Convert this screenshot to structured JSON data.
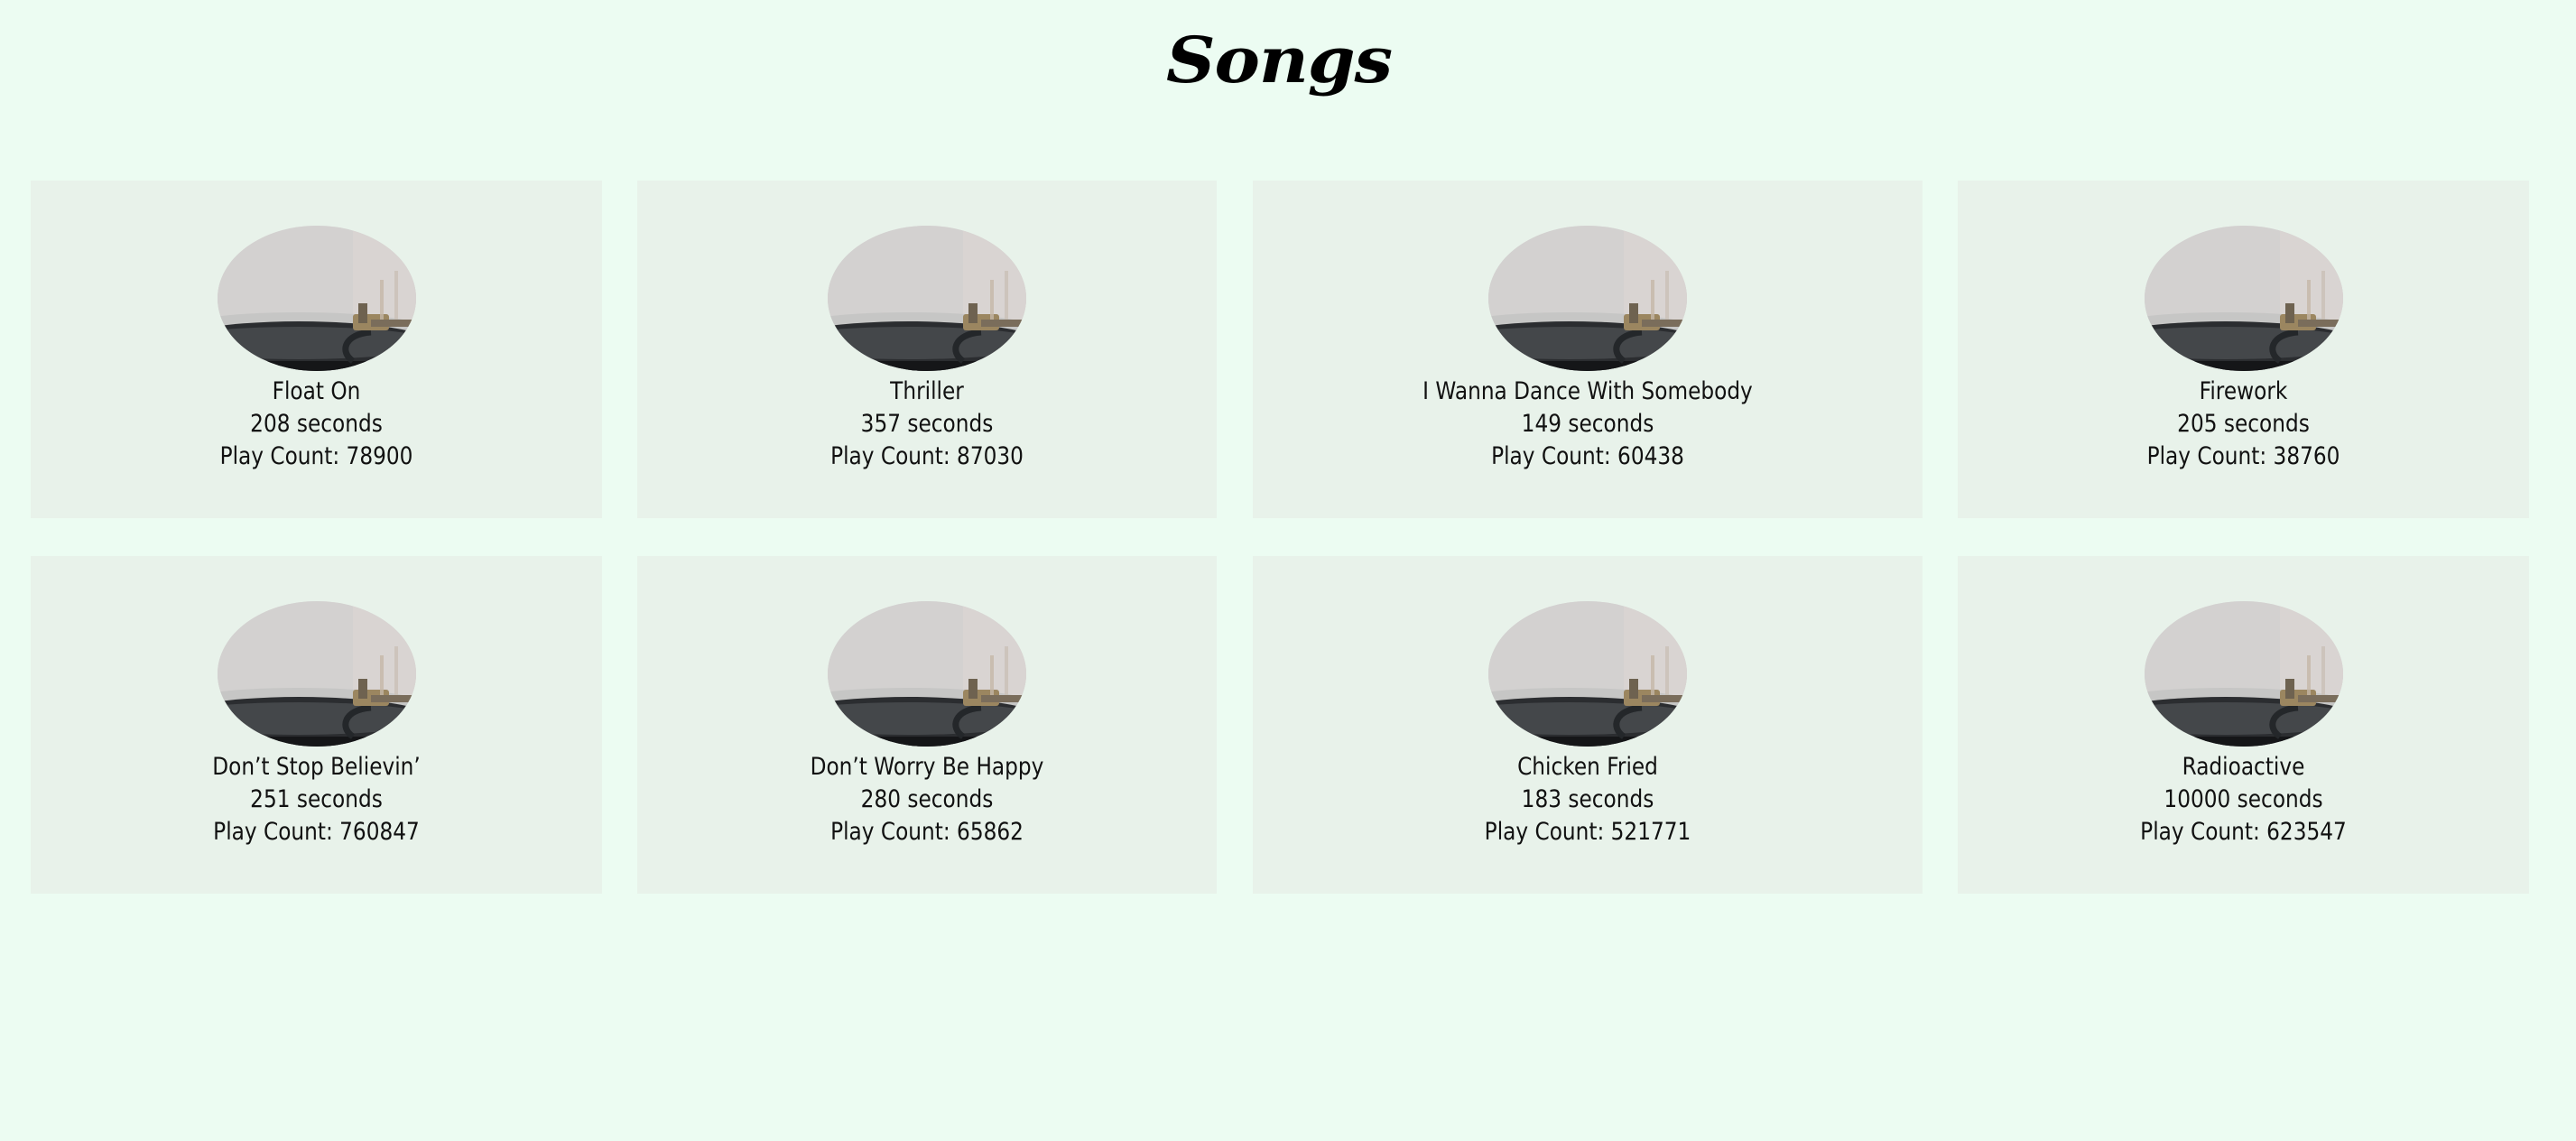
{
  "page": {
    "title": "Songs"
  },
  "colors": {
    "background": "#ecfcf2",
    "card_background": "#e8f2ea",
    "text": "#111111"
  },
  "songs": [
    {
      "title": "Float On",
      "duration": "208 seconds",
      "play_count": "Play Count: 78900",
      "image": "turntable-record-image"
    },
    {
      "title": "Thriller",
      "duration": "357 seconds",
      "play_count": "Play Count: 87030",
      "image": "turntable-record-image"
    },
    {
      "title": "I Wanna Dance With Somebody",
      "duration": "149 seconds",
      "play_count": "Play Count: 60438",
      "image": "turntable-record-image"
    },
    {
      "title": "Firework",
      "duration": "205 seconds",
      "play_count": "Play Count: 38760",
      "image": "turntable-record-image"
    },
    {
      "title": "Don’t Stop Believin’",
      "duration": "251 seconds",
      "play_count": "Play Count: 760847",
      "image": "turntable-record-image"
    },
    {
      "title": "Don’t Worry Be Happy",
      "duration": "280 seconds",
      "play_count": "Play Count: 65862",
      "image": "turntable-record-image"
    },
    {
      "title": "Chicken Fried",
      "duration": "183 seconds",
      "play_count": "Play Count: 521771",
      "image": "turntable-record-image"
    },
    {
      "title": "Radioactive",
      "duration": "10000 seconds",
      "play_count": "Play Count: 623547",
      "image": "turntable-record-image"
    }
  ]
}
